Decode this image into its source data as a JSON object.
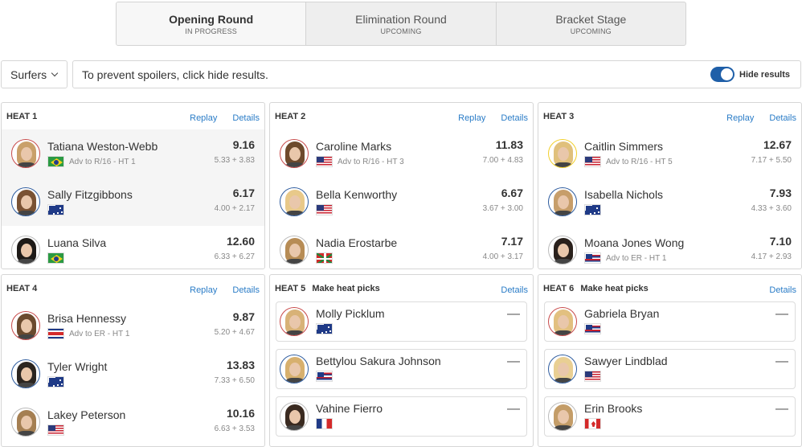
{
  "rounds": [
    {
      "name": "Opening Round",
      "status": "IN PROGRESS",
      "active": true
    },
    {
      "name": "Elimination Round",
      "status": "UPCOMING",
      "active": false
    },
    {
      "name": "Bracket Stage",
      "status": "UPCOMING",
      "active": false
    }
  ],
  "filter": {
    "surfers_label": "Surfers"
  },
  "spoiler": {
    "text": "To prevent spoilers, click hide results.",
    "toggle_label": "Hide results",
    "toggle_on": true
  },
  "links": {
    "replay": "Replay",
    "details": "Details"
  },
  "heats": [
    {
      "title": "HEAT 1",
      "picks_label": "",
      "surfers": [
        {
          "name": "Tatiana Weston-Webb",
          "flag": "bra",
          "adv": "Adv to R/16 - HT 1",
          "score": "9.16",
          "waves": "5.33 + 3.83",
          "ring": "red",
          "hair": "#c9a06a",
          "highlight": true
        },
        {
          "name": "Sally Fitzgibbons",
          "flag": "aus",
          "adv": "",
          "score": "6.17",
          "waves": "4.00 + 2.17",
          "ring": "blue",
          "hair": "#7a5233",
          "highlight": true
        },
        {
          "name": "Luana Silva",
          "flag": "bra",
          "adv": "",
          "score": "12.60",
          "waves": "6.33 + 6.27",
          "ring": "grey",
          "hair": "#1e1a17",
          "highlight": false
        }
      ]
    },
    {
      "title": "HEAT 2",
      "picks_label": "",
      "surfers": [
        {
          "name": "Caroline Marks",
          "flag": "usa",
          "adv": "Adv to R/16 - HT 3",
          "score": "11.83",
          "waves": "7.00 + 4.83",
          "ring": "red",
          "hair": "#6e4a2c"
        },
        {
          "name": "Bella Kenworthy",
          "flag": "usa",
          "adv": "",
          "score": "6.67",
          "waves": "3.67 + 3.00",
          "ring": "blue",
          "hair": "#e8c98a"
        },
        {
          "name": "Nadia Erostarbe",
          "flag": "bas",
          "adv": "",
          "score": "7.17",
          "waves": "4.00 + 3.17",
          "ring": "grey",
          "hair": "#b78c55"
        }
      ]
    },
    {
      "title": "HEAT 3",
      "picks_label": "",
      "surfers": [
        {
          "name": "Caitlin Simmers",
          "flag": "usa",
          "adv": "Adv to R/16 - HT 5",
          "score": "12.67",
          "waves": "7.17 + 5.50",
          "ring": "gold",
          "hair": "#e0c07c"
        },
        {
          "name": "Isabella Nichols",
          "flag": "aus",
          "adv": "",
          "score": "7.93",
          "waves": "4.33 + 3.60",
          "ring": "blue",
          "hair": "#c79e6a"
        },
        {
          "name": "Moana Jones Wong",
          "flag": "haw",
          "adv": "Adv to ER - HT 1",
          "score": "7.10",
          "waves": "4.17 + 2.93",
          "ring": "grey",
          "hair": "#2a211c"
        }
      ]
    },
    {
      "title": "HEAT 4",
      "picks_label": "",
      "surfers": [
        {
          "name": "Brisa Hennessy",
          "flag": "crc",
          "adv": "Adv to ER - HT 1",
          "score": "9.87",
          "waves": "5.20 + 4.67",
          "ring": "red",
          "hair": "#6b4a2e"
        },
        {
          "name": "Tyler Wright",
          "flag": "aus",
          "adv": "",
          "score": "13.83",
          "waves": "7.33 + 6.50",
          "ring": "blue",
          "hair": "#2b2520"
        },
        {
          "name": "Lakey Peterson",
          "flag": "usa",
          "adv": "",
          "score": "10.16",
          "waves": "6.63 + 3.53",
          "ring": "grey",
          "hair": "#a57f52"
        }
      ]
    },
    {
      "title": "HEAT 5",
      "picks_label": "Make heat picks",
      "surfers": [
        {
          "name": "Molly Picklum",
          "flag": "aus",
          "score": "—",
          "ring": "red",
          "hair": "#d8b277"
        },
        {
          "name": "Bettylou Sakura Johnson",
          "flag": "haw",
          "score": "—",
          "ring": "blue",
          "hair": "#d7b06e"
        },
        {
          "name": "Vahine Fierro",
          "flag": "fra",
          "score": "—",
          "ring": "grey",
          "hair": "#3a2a20"
        }
      ]
    },
    {
      "title": "HEAT 6",
      "picks_label": "Make heat picks",
      "surfers": [
        {
          "name": "Gabriela Bryan",
          "flag": "haw",
          "score": "—",
          "ring": "red",
          "hair": "#e2c080"
        },
        {
          "name": "Sawyer Lindblad",
          "flag": "usa",
          "score": "—",
          "ring": "blue",
          "hair": "#e9cf93"
        },
        {
          "name": "Erin Brooks",
          "flag": "can",
          "score": "—",
          "ring": "grey",
          "hair": "#c49d68"
        }
      ]
    }
  ]
}
